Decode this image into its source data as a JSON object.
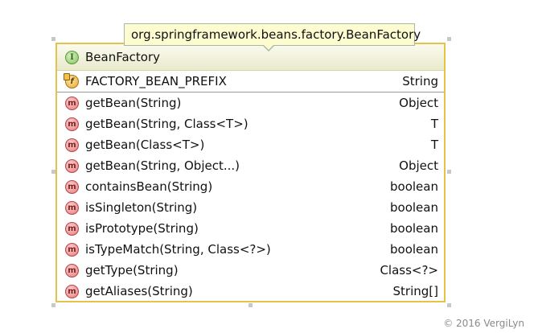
{
  "tooltip": {
    "text": "org.springframework.beans.factory.BeanFactory"
  },
  "class_box": {
    "stereotype_icon_letter": "I",
    "name": "BeanFactory",
    "fields": [
      {
        "icon_letter": "f",
        "name": "FACTORY_BEAN_PREFIX",
        "type": "String"
      }
    ],
    "methods": [
      {
        "icon_letter": "m",
        "name": "getBean(String)",
        "type": "Object"
      },
      {
        "icon_letter": "m",
        "name": "getBean(String, Class<T>)",
        "type": "T"
      },
      {
        "icon_letter": "m",
        "name": "getBean(Class<T>)",
        "type": "T"
      },
      {
        "icon_letter": "m",
        "name": "getBean(String, Object...)",
        "type": "Object"
      },
      {
        "icon_letter": "m",
        "name": "containsBean(String)",
        "type": "boolean"
      },
      {
        "icon_letter": "m",
        "name": "isSingleton(String)",
        "type": "boolean"
      },
      {
        "icon_letter": "m",
        "name": "isPrototype(String)",
        "type": "boolean"
      },
      {
        "icon_letter": "m",
        "name": "isTypeMatch(String, Class<?>)",
        "type": "boolean"
      },
      {
        "icon_letter": "m",
        "name": "getType(String)",
        "type": "Class<?>"
      },
      {
        "icon_letter": "m",
        "name": "getAliases(String)",
        "type": "String[]"
      }
    ]
  },
  "copyright": "© 2016 VergiLyn",
  "colors": {
    "border": "#e7c24a",
    "interface_icon": "#86c163",
    "method_icon": "#e57a7a",
    "field_icon": "#e8a62b",
    "tooltip_bg": "#fdfbd0"
  }
}
